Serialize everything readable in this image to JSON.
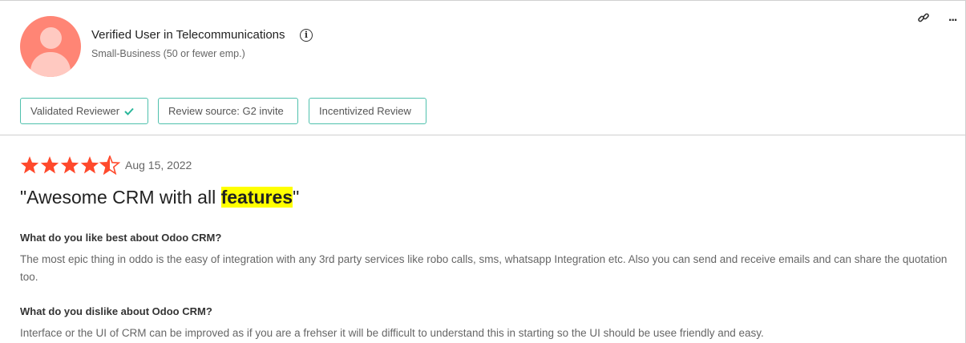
{
  "reviewer": {
    "name": "Verified User in Telecommunications",
    "segment": "Small-Business (50 or fewer emp.)",
    "avatar_color": "#ff8575"
  },
  "actions": {
    "link_icon": "link-icon",
    "more_icon": "more-icon",
    "more_label": "..."
  },
  "badges": [
    {
      "label": "Validated Reviewer",
      "icon": "check-icon"
    },
    {
      "label": "Review source: G2 invite"
    },
    {
      "label": "Incentivized Review"
    }
  ],
  "review": {
    "rating": 4.5,
    "max_rating": 5,
    "star_color": "#ff492c",
    "date": "Aug 15, 2022",
    "title_prefix": "\"Awesome CRM with all ",
    "title_highlight": "features",
    "title_suffix": "\"",
    "questions": [
      {
        "label": "What do you like best about Odoo CRM?",
        "answer": "The most epic thing in oddo is the easy of integration with any 3rd party services like robo calls, sms, whatsapp Integration etc. Also you can send and receive emails and can share the quotation too."
      },
      {
        "label": "What do you dislike about Odoo CRM?",
        "answer": "Interface or the UI of CRM can be improved as if you are a frehser it will be difficult to understand this in starting so the UI should be usee friendly and easy."
      }
    ]
  },
  "colors": {
    "badge_border": "#4fc1ad",
    "highlight": "#ffff00"
  }
}
